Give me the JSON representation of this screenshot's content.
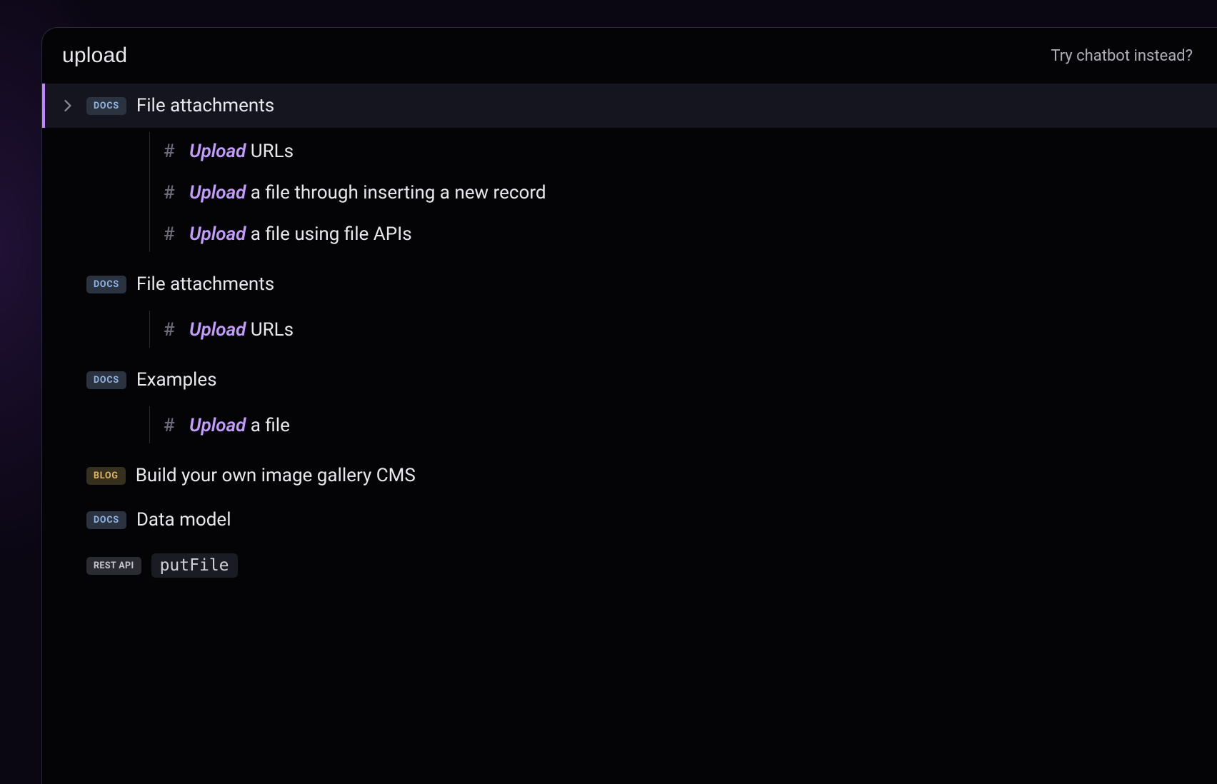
{
  "search": {
    "query": "upload",
    "chatbot_prompt": "Try chatbot instead?"
  },
  "badges": {
    "docs": "DOCS",
    "blog": "BLOG",
    "restapi": "REST API"
  },
  "hash": "#",
  "results": [
    {
      "badge": "docs",
      "title": "File attachments",
      "active": true,
      "has_chevron": true,
      "children": [
        {
          "highlight": "Upload",
          "rest": " URLs"
        },
        {
          "highlight": "Upload",
          "rest": " a file through inserting a new record"
        },
        {
          "highlight": "Upload",
          "rest": " a file using file APIs"
        }
      ]
    },
    {
      "badge": "docs",
      "title": "File attachments",
      "children": [
        {
          "highlight": "Upload",
          "rest": " URLs"
        }
      ]
    },
    {
      "badge": "docs",
      "title": "Examples",
      "children": [
        {
          "highlight": "Upload",
          "rest": " a file"
        }
      ]
    },
    {
      "badge": "blog",
      "title": "Build your own image gallery CMS"
    },
    {
      "badge": "docs",
      "title": "Data model"
    },
    {
      "badge": "restapi",
      "code": "putFile"
    }
  ]
}
